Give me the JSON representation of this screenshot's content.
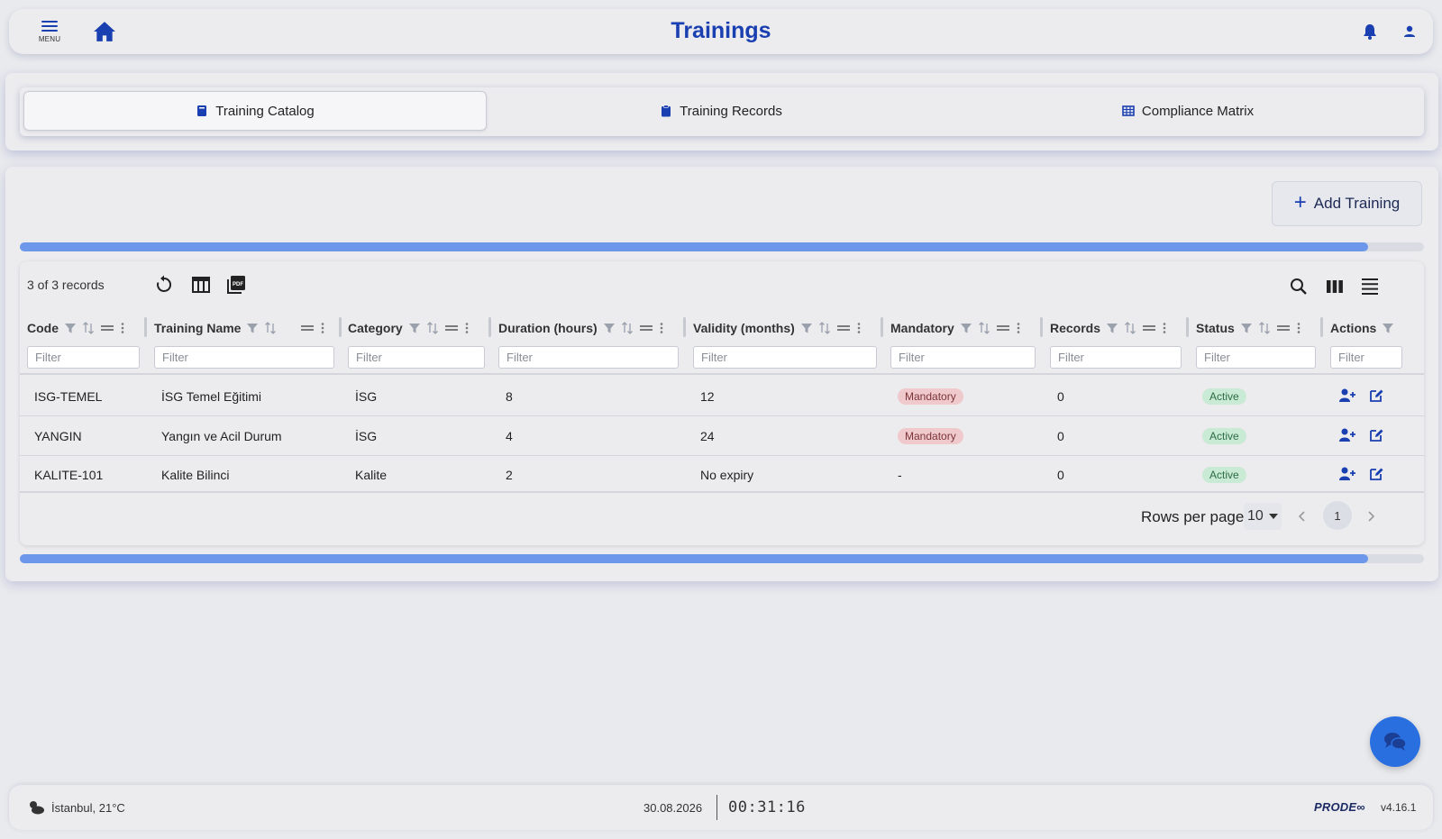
{
  "header": {
    "menu_label": "MENU",
    "title": "Trainings",
    "icons": [
      "menu-icon",
      "home-icon",
      "bell-icon",
      "user-icon"
    ],
    "accent_color": "#1a3fb0"
  },
  "tabs": [
    {
      "label": "Training Catalog",
      "icon": "book-icon",
      "active": true
    },
    {
      "label": "Training Records",
      "icon": "clipboard-icon",
      "active": false
    },
    {
      "label": "Compliance Matrix",
      "icon": "table-icon",
      "active": false
    }
  ],
  "toolbar": {
    "add_label": "Add Training",
    "progress": 0.96
  },
  "grid": {
    "records_label": "3 of 3 records",
    "filter_placeholder": "Filter",
    "columns": [
      "Code",
      "Training Name",
      "Category",
      "Duration (hours)",
      "Validity (months)",
      "Mandatory",
      "Records",
      "Status",
      "Actions"
    ],
    "rows": [
      {
        "code": "ISG-TEMEL",
        "name": "İSG Temel Eğitimi",
        "category": "İSG",
        "duration": "8",
        "validity": "12",
        "mandatory": "Mandatory",
        "records": "0",
        "status": "Active"
      },
      {
        "code": "YANGIN",
        "name": "Yangın ve Acil Durum",
        "category": "İSG",
        "duration": "4",
        "validity": "24",
        "mandatory": "Mandatory",
        "records": "0",
        "status": "Active"
      },
      {
        "code": "KALITE-101",
        "name": "Kalite Bilinci",
        "category": "Kalite",
        "duration": "2",
        "validity": "No expiry",
        "mandatory": "-",
        "records": "0",
        "status": "Active"
      }
    ],
    "pagination": {
      "rows_per_page_label": "Rows per page",
      "rows_per_page": "10",
      "current_page": "1"
    }
  },
  "footer": {
    "weather": "İstanbul, 21°C",
    "date": "30.08.2026",
    "time": "00:31:16",
    "brand": "PRODE∞",
    "version": "v4.16.1"
  }
}
